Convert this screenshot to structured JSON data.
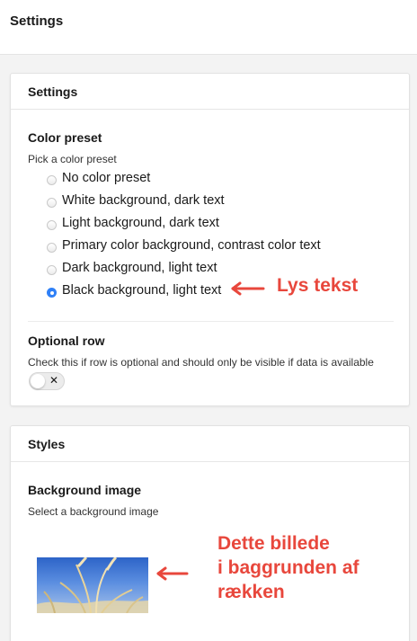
{
  "header": {
    "title": "Settings"
  },
  "settings_panel": {
    "title": "Settings",
    "color_preset": {
      "label": "Color preset",
      "description": "Pick a color preset",
      "options": [
        {
          "label": "No color preset",
          "checked": false
        },
        {
          "label": "White background, dark text",
          "checked": false
        },
        {
          "label": "Light background, dark text",
          "checked": false
        },
        {
          "label": "Primary color background, contrast color text",
          "checked": false
        },
        {
          "label": "Dark background, light text",
          "checked": false
        },
        {
          "label": "Black background, light text",
          "checked": true
        }
      ]
    },
    "optional_row": {
      "label": "Optional row",
      "description": "Check this if row is optional and should only be visible if data is available",
      "toggle_on": false,
      "toggle_glyph": "✕"
    }
  },
  "styles_panel": {
    "title": "Styles",
    "background_image": {
      "label": "Background image",
      "description": "Select a background image"
    }
  },
  "annotations": {
    "radio_note": "Lys tekst",
    "image_note_line1": "Dette billede",
    "image_note_line2": "i baggrunden af",
    "image_note_line3": "rækken"
  },
  "colors": {
    "accent": "#2f80f7",
    "annotation": "#e8473c",
    "page_background": "#f3f3f3"
  }
}
